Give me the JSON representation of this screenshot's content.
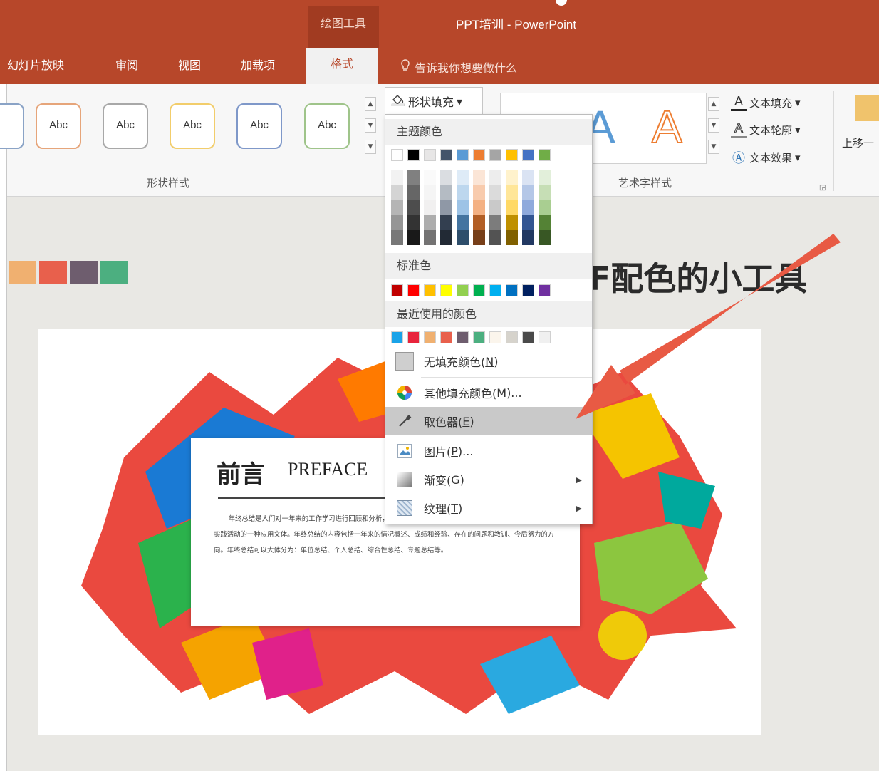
{
  "titlebar": {
    "contextual_group": "绘图工具",
    "window_title": "PPT培训 - PowerPoint"
  },
  "tabs": [
    {
      "label": "幻灯片放映"
    },
    {
      "label": "审阅"
    },
    {
      "label": "视图"
    },
    {
      "label": "加载项"
    }
  ],
  "active_tab": "格式",
  "tell_me": "告诉我你想要做什么",
  "ribbon": {
    "shape_style_label": "Abc",
    "shape_styles_group": "形状样式",
    "shape_fill_button": "形状填充",
    "wordart_letter": "A",
    "wordart_group": "艺术字样式",
    "text_fill": "文本填充",
    "text_outline": "文本轮廓",
    "text_effects": "文本效果",
    "move_up": "上移一"
  },
  "colors": {
    "accent": "#b7472a",
    "brand_dark": "#a13b21"
  },
  "dropdown": {
    "theme_colors_label": "主题颜色",
    "standard_colors_label": "标准色",
    "recent_colors_label": "最近使用的颜色",
    "theme_top_row": [
      "#ffffff",
      "#000000",
      "#e7e6e6",
      "#44546a",
      "#5b9bd5",
      "#ed7d31",
      "#a5a5a5",
      "#ffc000",
      "#4472c4",
      "#70ad47"
    ],
    "standard_colors": [
      "#c00000",
      "#ff0000",
      "#ffc000",
      "#ffff00",
      "#92d050",
      "#00b050",
      "#00b0f0",
      "#0070c0",
      "#002060",
      "#7030a0"
    ],
    "recent_colors": [
      "#1aa3e8",
      "#e8243c",
      "#f0b070",
      "#e8604c",
      "#6e5d6e",
      "#4caf80",
      "#fbf5ec",
      "#d6d3cc",
      "#4a4a4a",
      "#f0f0f0"
    ],
    "items": {
      "no_fill": {
        "label": "无填充颜色(",
        "key": "N",
        "tail": ")"
      },
      "more_colors": {
        "label": "其他填充颜色(",
        "key": "M",
        "tail": ")..."
      },
      "eyedropper": {
        "label": "取色器(",
        "key": "E",
        "tail": ")"
      },
      "picture": {
        "label": "图片(",
        "key": "P",
        "tail": ")..."
      },
      "gradient": {
        "label": "渐变(",
        "key": "G",
        "tail": ")"
      },
      "texture": {
        "label": "纹理(",
        "key": "T",
        "tail": ")"
      }
    }
  },
  "slide": {
    "palette": [
      "#f0b070",
      "#e8604c",
      "#6e5d6e",
      "#4caf80"
    ],
    "heading": "F配色的小工具",
    "preface_title": "前言",
    "preface_en": "PREFACE",
    "preface_body": "年终总结是人们对一年来的工作学习进行回顾和分析，从中找出经验和教训，引出规律性认识，以指导今后工作和实践活动的一种应用文体。年终总结的内容包括一年来的情况概述、成绩和经验、存在的问题和教训、今后努力的方向。年终总结可以大体分为：单位总结、个人总结、综合性总结、专题总结等。"
  }
}
